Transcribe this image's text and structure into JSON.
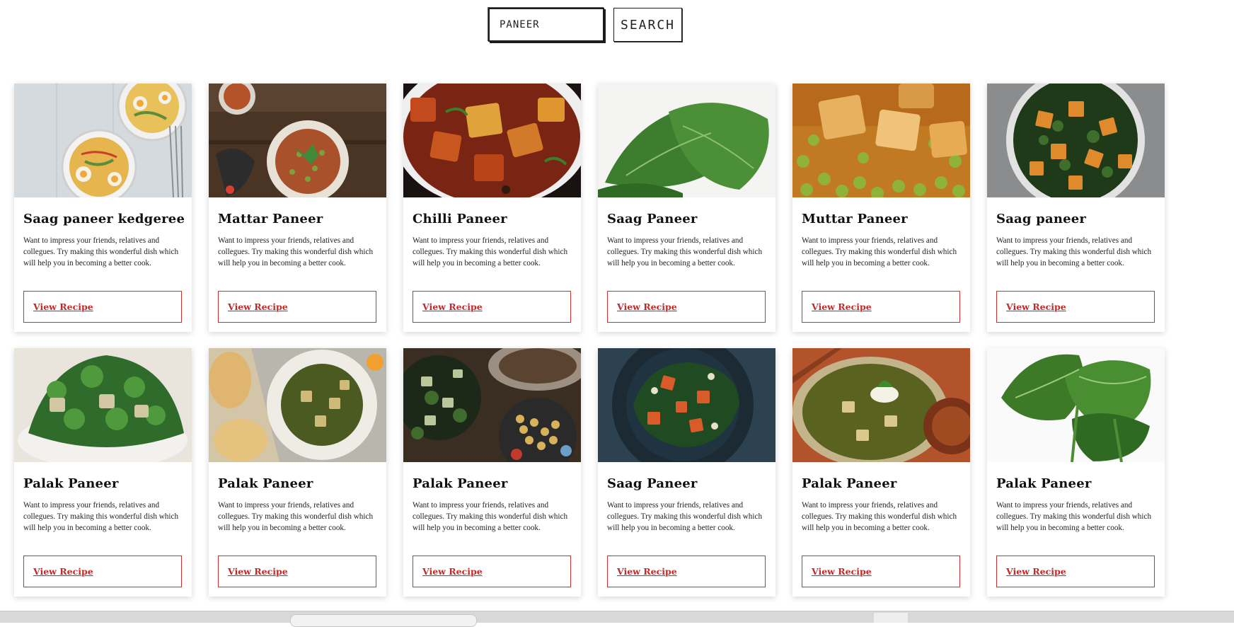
{
  "search": {
    "value": "PANEER",
    "button_label": "SEARCH"
  },
  "recipes": [
    {
      "title": "Saag paneer kedgeree",
      "description": "Want to impress your friends, relatives and collegues. Try making this wonderful dish which will help you in becoming a better cook.",
      "link": "View Recipe"
    },
    {
      "title": "Mattar Paneer",
      "description": "Want to impress your friends, relatives and collegues. Try making this wonderful dish which will help you in becoming a better cook.",
      "link": "View Recipe"
    },
    {
      "title": "Chilli Paneer",
      "description": "Want to impress your friends, relatives and collegues. Try making this wonderful dish which will help you in becoming a better cook.",
      "link": "View Recipe"
    },
    {
      "title": "Saag Paneer",
      "description": "Want to impress your friends, relatives and collegues. Try making this wonderful dish which will help you in becoming a better cook.",
      "link": "View Recipe"
    },
    {
      "title": "Muttar Paneer",
      "description": "Want to impress your friends, relatives and collegues. Try making this wonderful dish which will help you in becoming a better cook.",
      "link": "View Recipe"
    },
    {
      "title": "Saag paneer",
      "description": "Want to impress your friends, relatives and collegues. Try making this wonderful dish which will help you in becoming a better cook.",
      "link": "View Recipe"
    },
    {
      "title": "Palak Paneer",
      "description": "Want to impress your friends, relatives and collegues. Try making this wonderful dish which will help you in becoming a better cook.",
      "link": "View Recipe"
    },
    {
      "title": "Palak Paneer",
      "description": "Want to impress your friends, relatives and collegues. Try making this wonderful dish which will help you in becoming a better cook.",
      "link": "View Recipe"
    },
    {
      "title": "Palak Paneer",
      "description": "Want to impress your friends, relatives and collegues. Try making this wonderful dish which will help you in becoming a better cook.",
      "link": "View Recipe"
    },
    {
      "title": "Saag Paneer",
      "description": "Want to impress your friends, relatives and collegues. Try making this wonderful dish which will help you in becoming a better cook.",
      "link": "View Recipe"
    },
    {
      "title": "Palak Paneer",
      "description": "Want to impress your friends, relatives and collegues. Try making this wonderful dish which will help you in becoming a better cook.",
      "link": "View Recipe"
    },
    {
      "title": "Palak Paneer",
      "description": "Want to impress your friends, relatives and collegues. Try making this wonderful dish which will help you in becoming a better cook.",
      "link": "View Recipe"
    }
  ],
  "colors": {
    "accent_red": "#c62828",
    "card_border_red": "#d32f2f"
  }
}
